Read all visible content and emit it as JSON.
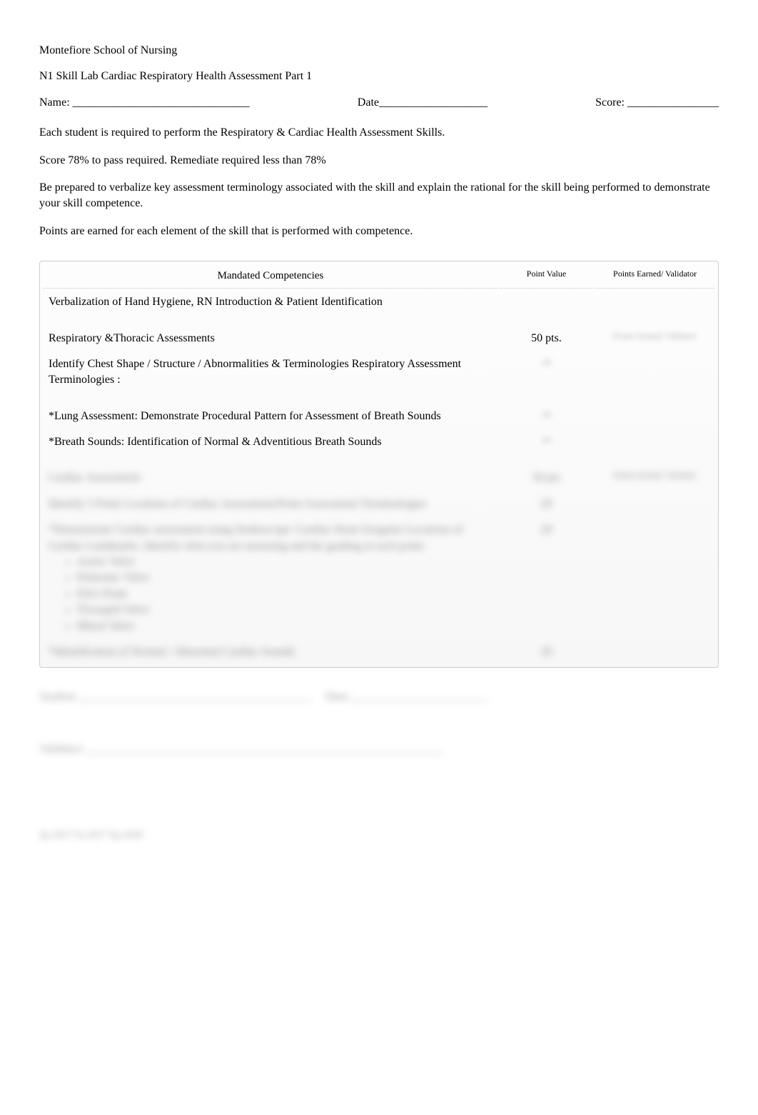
{
  "header": {
    "school": "Montefiore School of Nursing",
    "title": "N1 Skill Lab Cardiac Respiratory Health Assessment Part 1",
    "name_label": "Name: _______________________________",
    "date_label": "Date___________________",
    "score_label": "Score: ________________"
  },
  "instructions": {
    "line1": "Each student is required to perform the Respiratory & Cardiac Health Assessment Skills.",
    "line2": "Score 78% to pass required. Remediate required less than 78%",
    "line3": "Be prepared to verbalize key assessment terminology associated with the skill and explain the rational for the skill being performed to demonstrate your skill competence.",
    "line4": "Points are earned for each element of the skill that is performed with competence."
  },
  "table": {
    "headers": {
      "competencies": "Mandated Competencies",
      "point_value": "Point Value",
      "points_earned": "Points Earned/ Validator"
    },
    "rows": [
      {
        "comp": "Verbalization of Hand Hygiene, RN Introduction & Patient Identification",
        "pv": "",
        "pe": ""
      },
      {
        "comp": "Respiratory &Thoracic Assessments",
        "pv": "50 pts.",
        "pe_sub": "Points Earned/ Validator"
      },
      {
        "comp": "Identify Chest Shape / Structure / Abnormalities & Terminologies Respiratory Assessment Terminologies :",
        "pv_blur": "20",
        "pe": ""
      },
      {
        "comp": "*Lung Assessment: Demonstrate Procedural Pattern for Assessment of Breath  Sounds",
        "pv_blur": "20",
        "pe": ""
      },
      {
        "comp": "*Breath Sounds:  Identification of Normal & Adventitious Breath Sounds",
        "pv_blur": "20",
        "pe": ""
      }
    ],
    "blurred_section": {
      "title": "Cardiac Assessment",
      "pv": "50 pts",
      "pe_sub": "Points Earned/ Validator",
      "rows": [
        "Identify 5 Point Locations of Cardiac Assessment/Point Assessment Terminologies",
        "*Demonstrate Cardiac assessment using Stethoscope: Cardiac Heart Irregular Locations of Cardiac Landmarks. Identify what you are assessing and the grading at each point:",
        "*Identification of Normal / Abnormal Cardiac Sounds"
      ],
      "bullets": [
        "Aortic Valve",
        "Pulmonic Valve",
        "Erb's Point",
        "Tricuspid Valve",
        "Mitral Valve"
      ]
    }
  },
  "signatures": {
    "student": "Student:_________________________________________",
    "date": "Date:________________________",
    "validator": "Validator:_______________________________________________________________"
  },
  "footer": "Sp 2017   Fa 2017   Sp 2020"
}
